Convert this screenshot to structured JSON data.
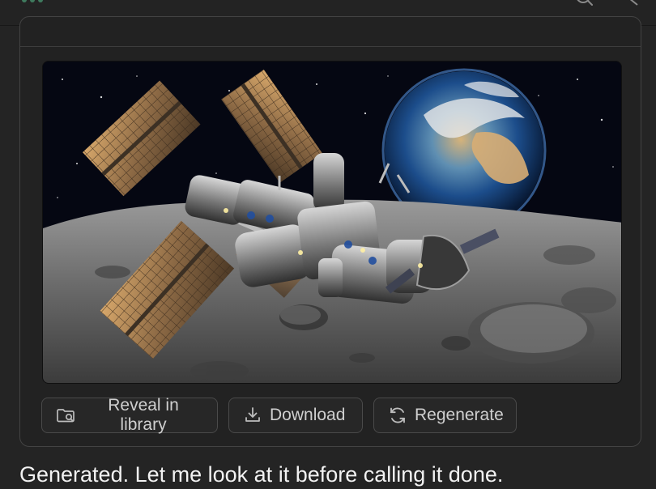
{
  "image": {
    "description": "",
    "icon": "generated-image"
  },
  "actions": {
    "reveal": {
      "label": "Reveal in library",
      "icon": "folder-search-icon"
    },
    "download": {
      "label": "Download",
      "icon": "download-icon"
    },
    "regenerate": {
      "label": "Regenerate",
      "icon": "refresh-icon"
    }
  },
  "message": {
    "text": "Generated. Let me look at it before calling it done."
  },
  "colors": {
    "background": "#242424",
    "card_border": "#434343",
    "button_border": "#4a4a4a",
    "text": "#e8e8e8"
  }
}
